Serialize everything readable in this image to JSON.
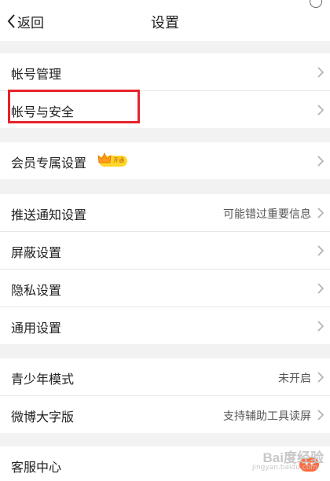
{
  "header": {
    "back_label": "返回",
    "title": "设置"
  },
  "groups": [
    {
      "items": [
        {
          "label": "帐号管理"
        },
        {
          "label": "帐号与安全"
        }
      ]
    },
    {
      "items": [
        {
          "label": "会员专属设置",
          "badge": "开通"
        }
      ]
    },
    {
      "items": [
        {
          "label": "推送通知设置",
          "value": "可能错过重要信息"
        },
        {
          "label": "屏蔽设置"
        },
        {
          "label": "隐私设置"
        },
        {
          "label": "通用设置"
        }
      ]
    },
    {
      "items": [
        {
          "label": "青少年模式",
          "value": "未开启"
        },
        {
          "label": "微博大字版",
          "value": "支持辅助工具读屏"
        }
      ]
    },
    {
      "items": [
        {
          "label": "客服中心"
        }
      ]
    }
  ],
  "watermark": {
    "brand": "Bai度经验",
    "sub": "jingyan.baidu.com"
  },
  "colors": {
    "highlight": "#e8222a",
    "badge": "#ffd629",
    "background": "#f2f2f2"
  }
}
